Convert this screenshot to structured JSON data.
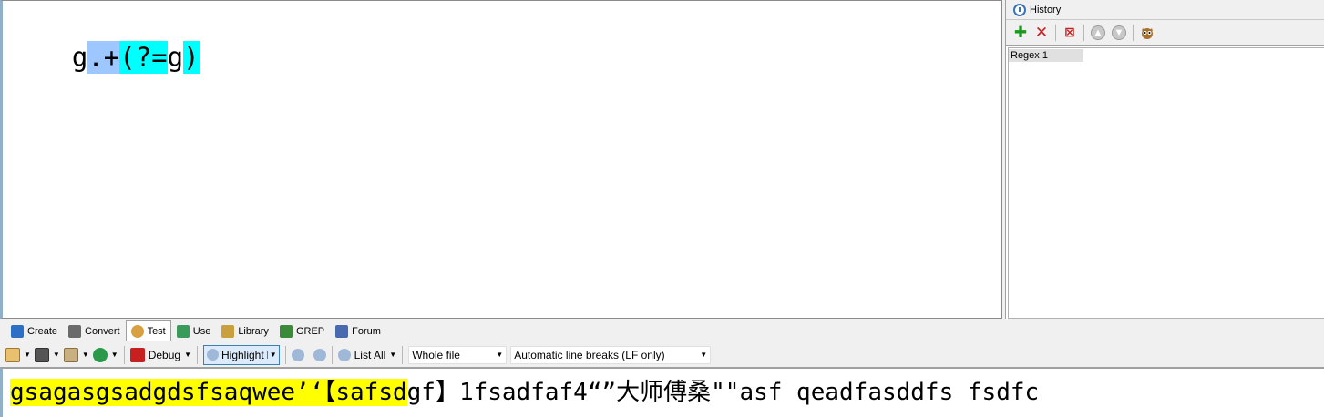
{
  "regex": {
    "tokens": [
      {
        "text": "g",
        "style": "plain"
      },
      {
        "text": ".+",
        "style": "blue"
      },
      {
        "text": "(?=",
        "style": "cyan"
      },
      {
        "text": "g",
        "style": "plain"
      },
      {
        "text": ")",
        "style": "cyan"
      }
    ]
  },
  "history": {
    "title": "History",
    "items": [
      "Regex 1"
    ],
    "toolbar_icons": [
      "add-icon",
      "delete-icon",
      "delete-all-icon",
      "move-up-icon",
      "move-down-icon",
      "owl-icon"
    ]
  },
  "tabs": [
    {
      "label": "Create",
      "icon": "create-icon",
      "active": false
    },
    {
      "label": "Convert",
      "icon": "convert-icon",
      "active": false
    },
    {
      "label": "Test",
      "icon": "test-icon",
      "active": true
    },
    {
      "label": "Use",
      "icon": "use-icon",
      "active": false
    },
    {
      "label": "Library",
      "icon": "library-icon",
      "active": false
    },
    {
      "label": "GREP",
      "icon": "grep-icon",
      "active": false
    },
    {
      "label": "Forum",
      "icon": "forum-icon",
      "active": false
    }
  ],
  "test_toolbar": {
    "debug_label": "Debug",
    "highlight_label": "Highlight",
    "list_all_label": "List All",
    "scope": "Whole file",
    "line_breaks": "Automatic line breaks (LF only)"
  },
  "subject": {
    "matched": "gsagasgsadgdsfsaqwee’‘【safsd",
    "rest": "gf】1fsadfaf4“”大师傅桑\"\"asf qeadfasddfs fsdfc"
  },
  "colors": {
    "token_blue": "#9ec7ff",
    "token_cyan": "#00ffff",
    "match_highlight": "#ffff00"
  }
}
